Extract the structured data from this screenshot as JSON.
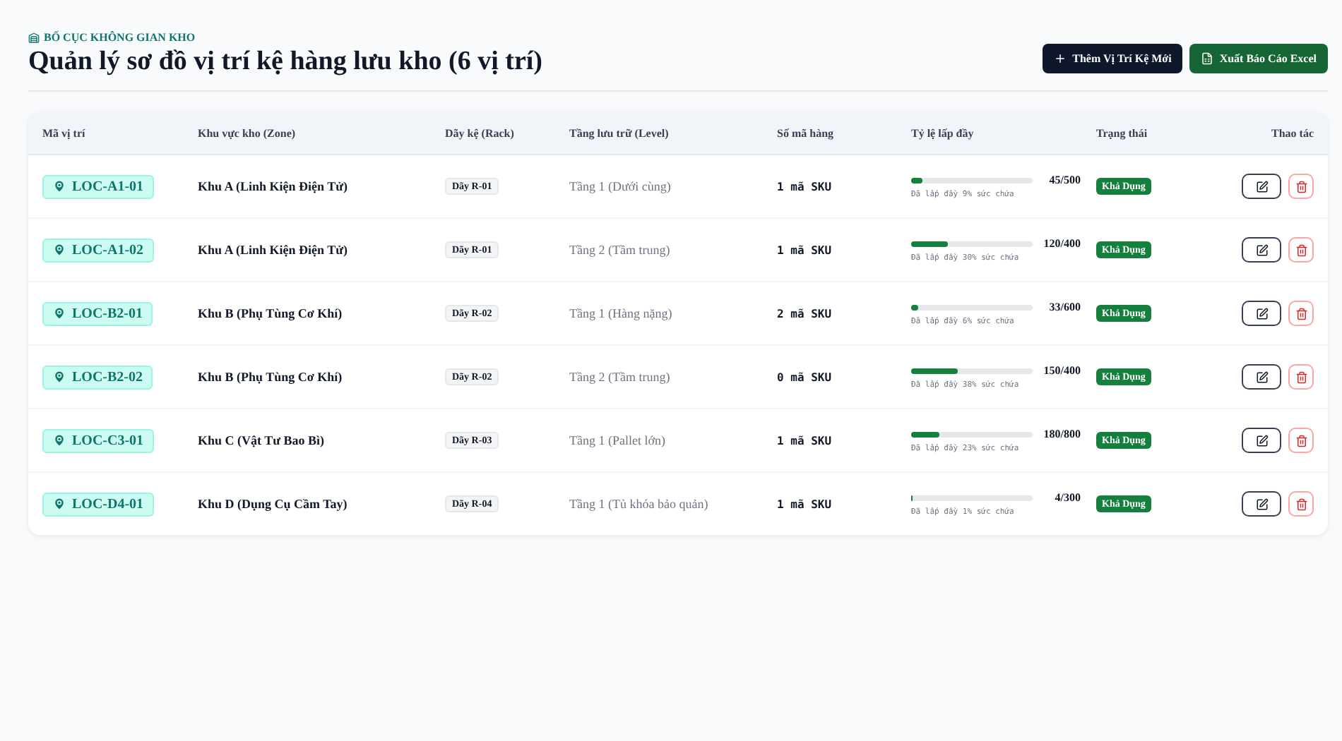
{
  "header": {
    "eyebrow": "BỐ CỤC KHÔNG GIAN KHO",
    "title": "Quản lý sơ đồ vị trí kệ hàng lưu kho (6 vị trí)",
    "buttons": [
      {
        "label": "Thêm Vị Trí Kệ Mới",
        "kind": "add"
      },
      {
        "label": "Xuất Báo Cáo Excel",
        "kind": "export"
      }
    ]
  },
  "table": {
    "columns": [
      "Mã vị trí",
      "Khu vực kho (Zone)",
      "Dãy kệ (Rack)",
      "Tầng lưu trữ (Level)",
      "Số mã hàng",
      "Tỷ lệ lấp đầy",
      "Trạng thái",
      "Thao tác"
    ],
    "rows": [
      {
        "code": "LOC-A1-01",
        "zone": "Khu A (Linh Kiện Điện Tử)",
        "rack": "Dãy R-01",
        "level_name": "Tầng 1 (Dưới cùng)",
        "sku": "1 mã SKU",
        "capacity": "45/500",
        "level": 0.09,
        "fill_note": "Đã lấp đầy 9% sức chứa",
        "status": "Khả Dụng"
      },
      {
        "code": "LOC-A1-02",
        "zone": "Khu A (Linh Kiện Điện Tử)",
        "rack": "Dãy R-01",
        "level_name": "Tầng 2 (Tầm trung)",
        "sku": "1 mã SKU",
        "capacity": "120/400",
        "level": 0.3,
        "fill_note": "Đã lấp đầy 30% sức chứa",
        "status": "Khả Dụng"
      },
      {
        "code": "LOC-B2-01",
        "zone": "Khu B (Phụ Tùng Cơ Khí)",
        "rack": "Dãy R-02",
        "level_name": "Tầng 1 (Hàng nặng)",
        "sku": "2 mã SKU",
        "capacity": "33/600",
        "level": 0.06,
        "fill_note": "Đã lấp đầy 6% sức chứa",
        "status": "Khả Dụng"
      },
      {
        "code": "LOC-B2-02",
        "zone": "Khu B (Phụ Tùng Cơ Khí)",
        "rack": "Dãy R-02",
        "level_name": "Tầng 2 (Tầm trung)",
        "sku": "0 mã SKU",
        "capacity": "150/400",
        "level": 0.38,
        "fill_note": "Đã lấp đầy 38% sức chứa",
        "status": "Khả Dụng"
      },
      {
        "code": "LOC-C3-01",
        "zone": "Khu C (Vật Tư Bao Bì)",
        "rack": "Dãy R-03",
        "level_name": "Tầng 1 (Pallet lớn)",
        "sku": "1 mã SKU",
        "capacity": "180/800",
        "level": 0.23,
        "fill_note": "Đã lấp đầy 23% sức chứa",
        "status": "Khả Dụng"
      },
      {
        "code": "LOC-D4-01",
        "zone": "Khu D (Dụng Cụ Cầm Tay)",
        "rack": "Dãy R-04",
        "level_name": "Tầng 1 (Tủ khóa bảo quản)",
        "sku": "1 mã SKU",
        "capacity": "4/300",
        "level": 0.01,
        "fill_note": "Đã lấp đầy 1% sức chứa",
        "status": "Khả Dụng"
      }
    ]
  }
}
